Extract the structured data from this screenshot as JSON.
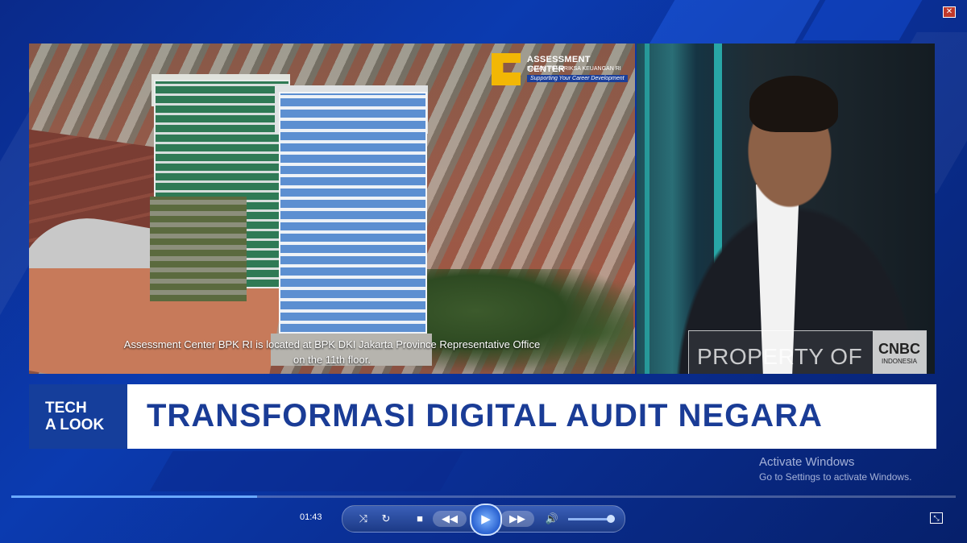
{
  "window": {
    "close_label": "✕"
  },
  "left_video": {
    "logo": {
      "title": "ASSESSMENT CENTER",
      "subtitle": "BADAN PEMERIKSA KEUANGAN RI",
      "tagline": "Supporting Your Career Development"
    },
    "caption_line1": "Assessment Center BPK RI is located at BPK DKI Jakarta Province Representative Office",
    "caption_line2": "on the 11th floor."
  },
  "right_video": {
    "watermark_text": "PROPERTY OF",
    "watermark_logo_line1": "CNBC",
    "watermark_logo_line2": "INDONESIA"
  },
  "lower_third": {
    "badge_line1": "TECH",
    "badge_line2": "A LOOK",
    "title": "TRANSFORMASI DIGITAL AUDIT NEGARA"
  },
  "os_notice": {
    "line1": "Activate Windows",
    "line2": "Go to Settings to activate Windows."
  },
  "player": {
    "time": "01:43",
    "progress_fraction": 0.26,
    "icons": {
      "shuffle": "shuffle-icon",
      "repeat": "repeat-icon",
      "stop": "stop-icon",
      "previous": "rewind-icon",
      "play": "play-icon",
      "next": "fast-forward-icon",
      "volume": "volume-icon",
      "mini": "mini-mode-icon"
    }
  },
  "colors": {
    "background_blue": "#0b3bb0",
    "badge_blue": "#153e9b",
    "title_blue": "#1a3c96",
    "accent_cyan": "#2cc4c0",
    "logo_yellow": "#f2b705"
  }
}
